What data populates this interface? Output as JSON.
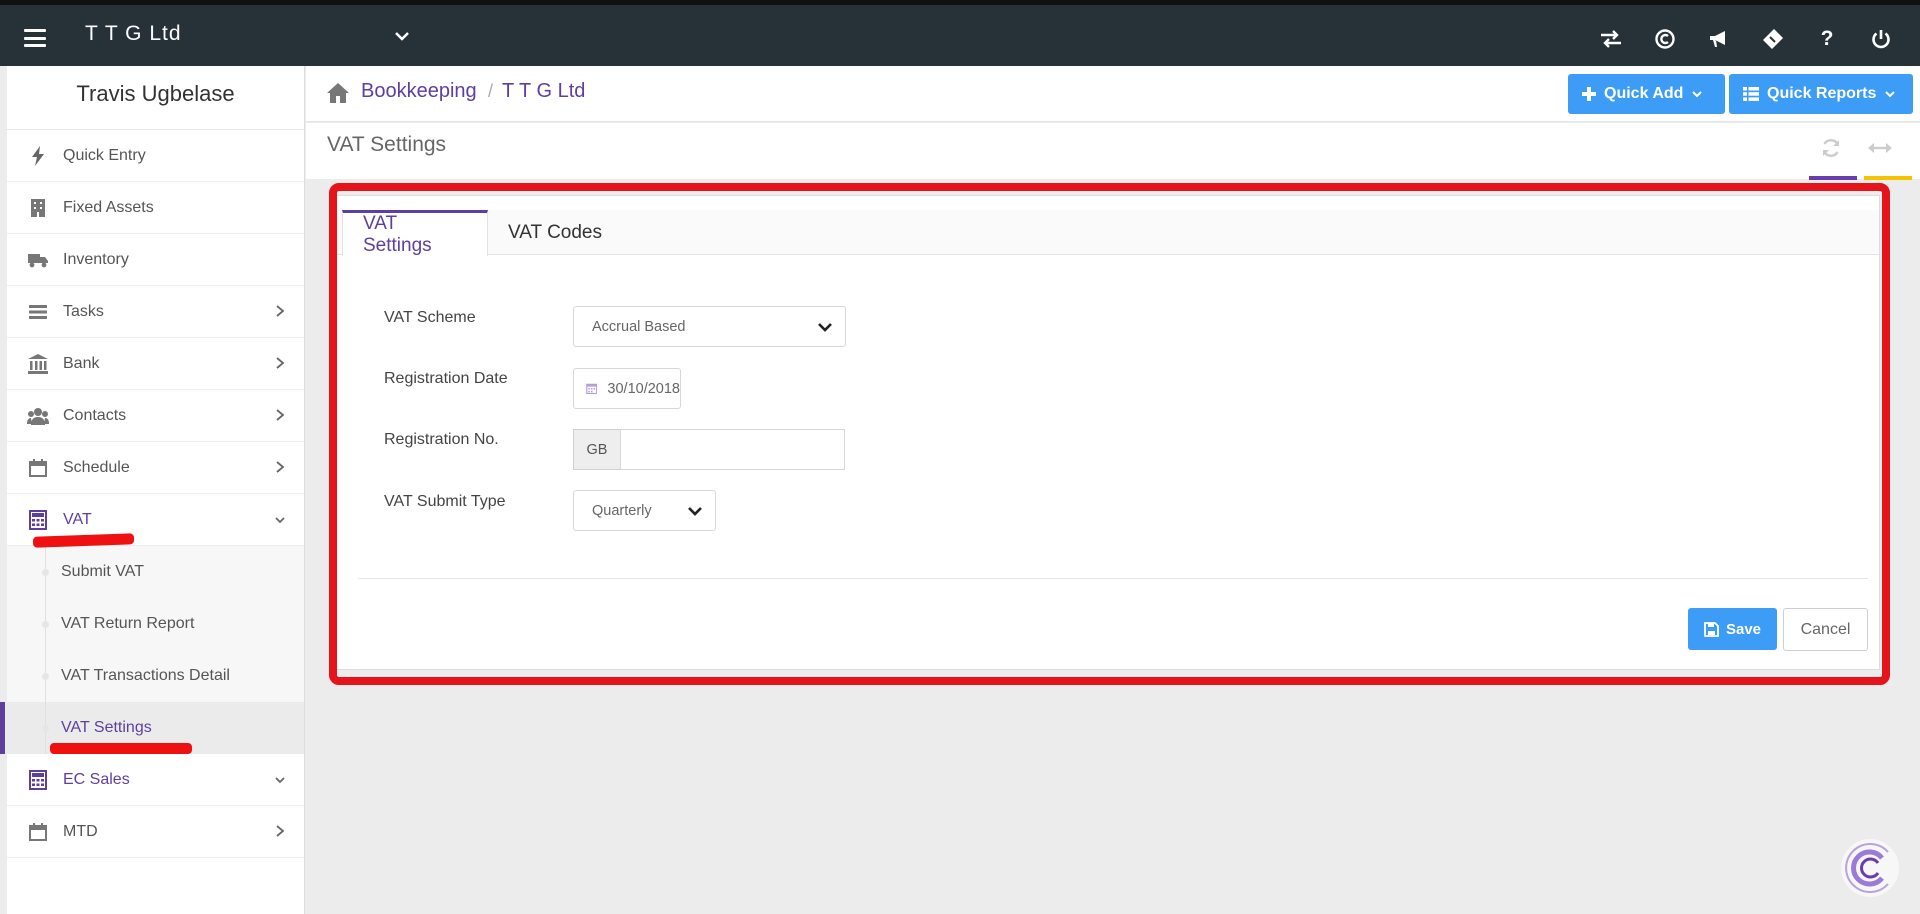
{
  "header": {
    "company": "T T G Ltd",
    "icons": [
      "transfer-icon",
      "currency-icon",
      "megaphone-icon",
      "ticket-icon",
      "help-icon",
      "power-icon"
    ],
    "help_glyph": "?"
  },
  "sidebar": {
    "user_name": "Travis Ugbelase",
    "items": [
      {
        "label": "Quick Entry",
        "icon": "bolt-icon"
      },
      {
        "label": "Fixed Assets",
        "icon": "building-icon"
      },
      {
        "label": "Inventory",
        "icon": "truck-icon"
      },
      {
        "label": "Tasks",
        "icon": "tasks-icon"
      },
      {
        "label": "Bank",
        "icon": "bank-icon"
      },
      {
        "label": "Contacts",
        "icon": "users-icon"
      },
      {
        "label": "Schedule",
        "icon": "calendar-icon"
      },
      {
        "label": "VAT",
        "icon": "calculator-icon"
      },
      {
        "label": "EC Sales",
        "icon": "calculator-icon"
      },
      {
        "label": "MTD",
        "icon": "calendar-icon"
      }
    ],
    "vat_sub_items": [
      {
        "label": "Submit VAT"
      },
      {
        "label": "VAT Return Report"
      },
      {
        "label": "VAT Transactions Detail"
      },
      {
        "label": "VAT Settings"
      }
    ]
  },
  "breadcrumb": {
    "items": [
      "Bookkeeping",
      "T T G Ltd"
    ],
    "separator": "/"
  },
  "actions": {
    "quick_add": "Quick Add",
    "quick_reports": "Quick Reports"
  },
  "page": {
    "title": "VAT Settings"
  },
  "tabs": [
    "VAT Settings",
    "VAT Codes"
  ],
  "form": {
    "vat_scheme": {
      "label": "VAT Scheme",
      "value": "Accrual Based"
    },
    "registration_date": {
      "label": "Registration Date",
      "value": "30/10/2018"
    },
    "registration_no": {
      "label": "Registration No.",
      "prefix": "GB",
      "value": ""
    },
    "vat_submit_type": {
      "label": "VAT Submit Type",
      "value": "Quarterly"
    },
    "save": "Save",
    "cancel": "Cancel"
  },
  "colors": {
    "topbar": "#263238",
    "accent_purple": "#5e3fa0",
    "button_blue": "#3d9cf5",
    "highlight_red": "#e4141a"
  }
}
